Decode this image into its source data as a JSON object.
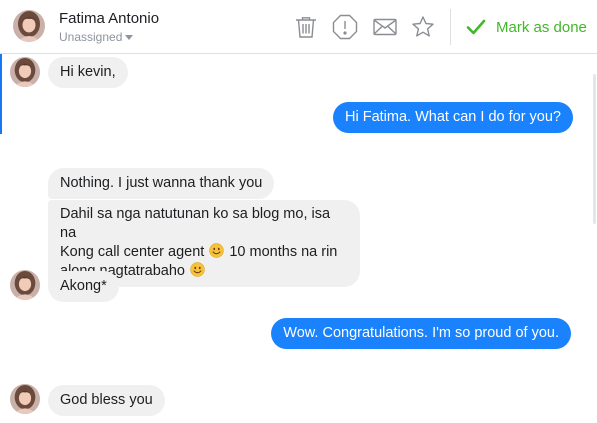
{
  "header": {
    "contact_name": "Fatima Antonio",
    "assignee": "Unassigned",
    "actions": {
      "delete": "trash-icon",
      "spam": "alert-icon",
      "unread": "envelope-icon",
      "star": "star-icon"
    },
    "mark_done_label": "Mark as done"
  },
  "colors": {
    "accent_blue": "#1982fc",
    "done_green": "#42b72a",
    "incoming_bubble": "#f0f0f0"
  },
  "messages": [
    {
      "direction": "incoming",
      "text": "Hi kevin,"
    },
    {
      "direction": "outgoing",
      "text": "Hi Fatima. What can I do for you?"
    },
    {
      "direction": "incoming",
      "text": "Nothing. I just wanna thank you"
    },
    {
      "direction": "incoming",
      "line1": "Dahil sa nga natutunan ko sa blog mo, isa na",
      "line2": "Kong call center agent",
      "line3": "10 months na rin",
      "line4": "along nagtatrabaho",
      "emoji": "smiling-face-emoji"
    },
    {
      "direction": "incoming",
      "text": "Akong*"
    },
    {
      "direction": "outgoing",
      "text": "Wow. Congratulations. I'm so proud of you."
    },
    {
      "direction": "incoming",
      "text": "God bless you"
    }
  ]
}
